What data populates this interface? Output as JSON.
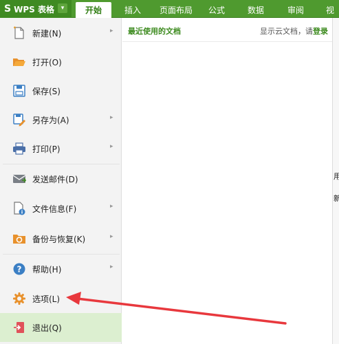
{
  "app": {
    "logo": "S",
    "name": "WPS 表格",
    "caret": "▾"
  },
  "tabs": [
    {
      "label": "开始"
    },
    {
      "label": "插入"
    },
    {
      "label": "页面布局"
    },
    {
      "label": "公式"
    },
    {
      "label": "数据"
    },
    {
      "label": "审阅"
    },
    {
      "label": "视图"
    }
  ],
  "menu": {
    "items": [
      {
        "label": "新建(N)",
        "icon": "new-document-icon",
        "submenu": true
      },
      {
        "label": "打开(O)",
        "icon": "folder-open-icon",
        "submenu": false
      },
      {
        "label": "保存(S)",
        "icon": "save-icon",
        "submenu": false
      },
      {
        "label": "另存为(A)",
        "icon": "save-as-icon",
        "submenu": true
      },
      {
        "label": "打印(P)",
        "icon": "printer-icon",
        "submenu": true
      },
      {
        "label": "发送邮件(D)",
        "icon": "mail-icon",
        "submenu": false
      },
      {
        "label": "文件信息(F)",
        "icon": "file-info-icon",
        "submenu": true
      },
      {
        "label": "备份与恢复(K)",
        "icon": "backup-restore-icon",
        "submenu": true
      },
      {
        "label": "帮助(H)",
        "icon": "help-icon",
        "submenu": true
      },
      {
        "label": "选项(L)",
        "icon": "gear-icon",
        "submenu": false
      },
      {
        "label": "退出(Q)",
        "icon": "exit-icon",
        "submenu": false
      }
    ],
    "submenu_arrow": "▸"
  },
  "recent": {
    "title": "最近使用的文档",
    "cloud_hint": "显示云文档，请",
    "login": "登录"
  },
  "underlying": {
    "chars": [
      "用",
      "新"
    ]
  },
  "colors": {
    "brand": "#4f9a2f",
    "annotation": "#e8383d"
  }
}
